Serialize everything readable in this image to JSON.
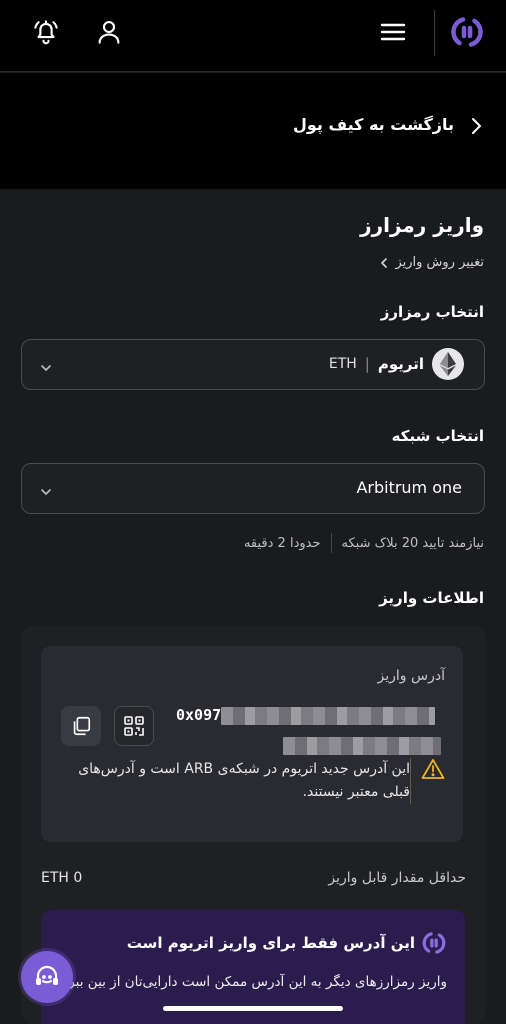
{
  "header": {
    "icons": [
      "logo-icon",
      "menu-icon",
      "user-icon",
      "bell-icon"
    ],
    "brand_color": "#7c5cd6"
  },
  "back": {
    "label": "بازگشت به کیف پول"
  },
  "deposit": {
    "title": "واریز رمزارز",
    "change_method": "تغییر روش واریز",
    "select_crypto_label": "انتخاب رمزارز",
    "crypto": {
      "name": "اتریوم",
      "separator": "|",
      "symbol": "ETH"
    },
    "select_network_label": "انتخاب شبکه",
    "network": {
      "value": "Arbitrum one"
    },
    "network_info": {
      "confirmations": "نیازمند تایید 20 بلاک شبکه",
      "time": "حدودا 2 دقیقه"
    },
    "info_label": "اطلاعات واریز"
  },
  "address_card": {
    "label": "آدرس واریز",
    "address_prefix": "0x097",
    "warning": "این آدرس جدید اتریوم در شبکه‌ی ARB است و آدرس‌های قبلی معتبر نیستند."
  },
  "min_deposit": {
    "label": "حداقل مقدار قابل واریز",
    "value": "ETH 0"
  },
  "notice": {
    "title": "این آدرس فقط برای واریز اتریوم است",
    "body": "واریز رمزارزهای دیگر به این آدرس ممکن است دارایی‌تان از بین ببرد"
  },
  "colors": {
    "background": "#1a1b1e",
    "card": "#2a2b30",
    "notice": "#2a1d4e",
    "warning": "#f0b429"
  }
}
